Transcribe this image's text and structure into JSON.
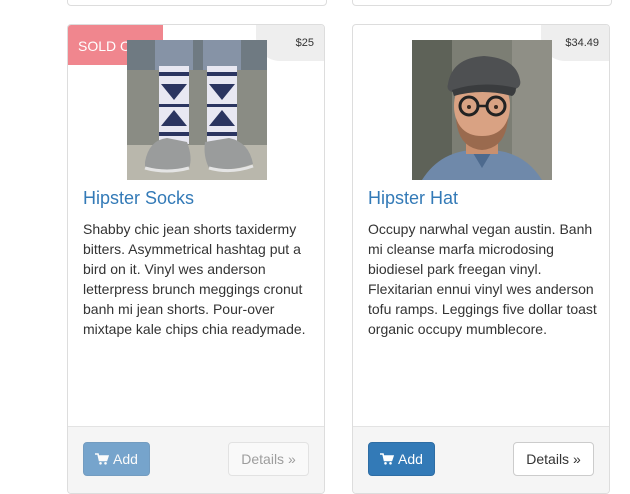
{
  "products": [
    {
      "name": "Hipster Socks",
      "price": "$25",
      "badge": "SOLD OUT!",
      "description": "Shabby chic jean shorts taxidermy bitters. Asymmetrical hashtag put a bird on it. Vinyl wes anderson letterpress brunch meggings cronut banh mi jean shorts. Pour-over mixtape kale chips chia readymade.",
      "add_label": "Add",
      "details_label": "Details »"
    },
    {
      "name": "Hipster Hat",
      "price": "$34.49",
      "description": "Occupy narwhal vegan austin. Banh mi cleanse marfa microdosing biodiesel park freegan vinyl. Flexitarian ennui vinyl wes anderson tofu ramps. Leggings five dollar toast organic occupy mumblecore.",
      "add_label": "Add",
      "details_label": "Details »"
    }
  ]
}
